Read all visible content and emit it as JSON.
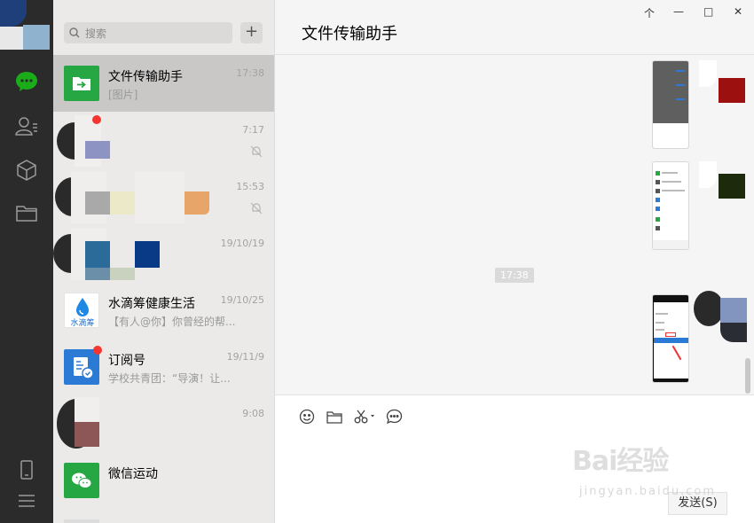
{
  "search": {
    "placeholder": "搜索",
    "add": "+"
  },
  "window": {
    "pin": "个",
    "minimize": "—",
    "maximize": "□",
    "close": "✕"
  },
  "chat": {
    "title": "文件传输助手",
    "timestamp": "17:38",
    "send_label": "发送(S)"
  },
  "conversations": [
    {
      "name": "文件传输助手",
      "message": "[图片]",
      "time": "17:38"
    },
    {
      "name": "",
      "message": "",
      "time": "7:17"
    },
    {
      "name": "",
      "message": "",
      "time": "15:53"
    },
    {
      "name": "",
      "message": "",
      "time": "19/10/19"
    },
    {
      "name": "水滴筹健康生活",
      "message": "【有人@你】你曾经的帮...",
      "time": "19/10/25",
      "avatar_text": "水滴筹"
    },
    {
      "name": "订阅号",
      "message": "学校共青团：“导演！让...",
      "time": "19/11/9"
    },
    {
      "name": "",
      "message": "",
      "time": "9:08"
    },
    {
      "name": "微信运动",
      "message": "",
      "time": ""
    }
  ],
  "watermark": {
    "brand": "Bai经验",
    "url": "jingyan.baidu.com"
  },
  "colors": {
    "accent": "#1aad19",
    "badge": "#f43530",
    "rail": "#2b2b2b"
  }
}
